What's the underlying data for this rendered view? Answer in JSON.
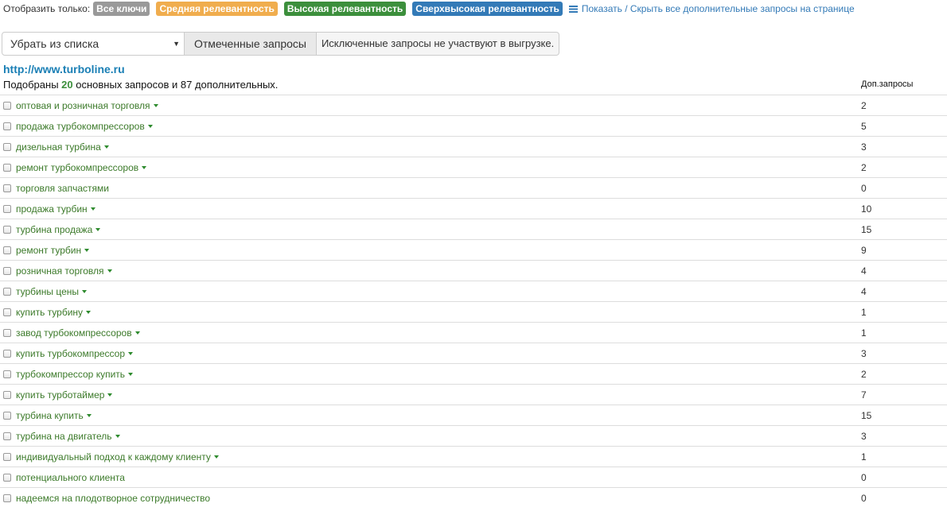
{
  "filter": {
    "label": "Отобразить только:",
    "badges": [
      {
        "label": "Все ключи",
        "color": "#999999"
      },
      {
        "label": "Средняя релевантность",
        "color": "#f0ad4e"
      },
      {
        "label": "Высокая релевантность",
        "color": "#3c8f3c"
      },
      {
        "label": "Сверхвысокая релевантность",
        "color": "#337ab7"
      }
    ],
    "toggle_icon": "list-icon",
    "toggle_link": "Показать / Скрыть все дополнительные запросы на странице"
  },
  "controls": {
    "select_value": "Убрать из списка",
    "marked_button": "Отмеченные запросы",
    "note": "Исключенные запросы не участвуют в выгрузке."
  },
  "site": {
    "url": "http://www.turboline.ru"
  },
  "summary": {
    "prefix": "Подобраны",
    "main_count": "20",
    "suffix": "основных запросов и 87 дополнительных."
  },
  "table": {
    "extra_header": "Доп.запросы",
    "rows": [
      {
        "keyword": "оптовая и розничная торговля",
        "dropdown": true,
        "extra": "2"
      },
      {
        "keyword": "продажа турбокомпрессоров",
        "dropdown": true,
        "extra": "5"
      },
      {
        "keyword": "дизельная турбина",
        "dropdown": true,
        "extra": "3"
      },
      {
        "keyword": "ремонт турбокомпрессоров",
        "dropdown": true,
        "extra": "2"
      },
      {
        "keyword": "торговля запчастями",
        "dropdown": false,
        "extra": "0"
      },
      {
        "keyword": "продажа турбин",
        "dropdown": true,
        "extra": "10"
      },
      {
        "keyword": "турбина продажа",
        "dropdown": true,
        "extra": "15"
      },
      {
        "keyword": "ремонт турбин",
        "dropdown": true,
        "extra": "9"
      },
      {
        "keyword": "розничная торговля",
        "dropdown": true,
        "extra": "4"
      },
      {
        "keyword": "турбины цены",
        "dropdown": true,
        "extra": "4"
      },
      {
        "keyword": "купить турбину",
        "dropdown": true,
        "extra": "1"
      },
      {
        "keyword": "завод турбокомпрессоров",
        "dropdown": true,
        "extra": "1"
      },
      {
        "keyword": "купить турбокомпрессор",
        "dropdown": true,
        "extra": "3"
      },
      {
        "keyword": "турбокомпрессор купить",
        "dropdown": true,
        "extra": "2"
      },
      {
        "keyword": "купить турботаймер",
        "dropdown": true,
        "extra": "7"
      },
      {
        "keyword": "турбина купить",
        "dropdown": true,
        "extra": "15"
      },
      {
        "keyword": "турбина на двигатель",
        "dropdown": true,
        "extra": "3"
      },
      {
        "keyword": "индивидуальный подход к каждому клиенту",
        "dropdown": true,
        "extra": "1"
      },
      {
        "keyword": "потенциального клиента",
        "dropdown": false,
        "extra": "0"
      },
      {
        "keyword": "надеемся на плодотворное сотрудничество",
        "dropdown": false,
        "extra": "0"
      }
    ]
  }
}
